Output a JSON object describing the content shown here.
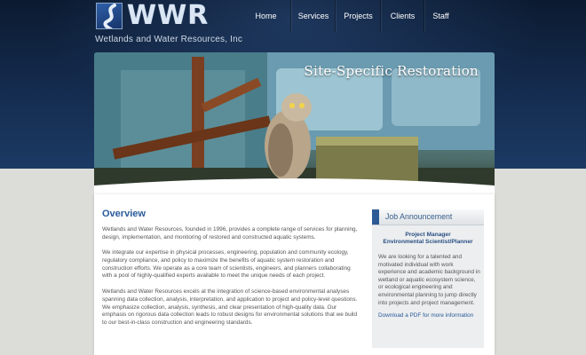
{
  "brand": {
    "logo_text": "WWR",
    "tagline": "Wetlands and Water Resources, Inc"
  },
  "nav": {
    "items": [
      {
        "label": "Home"
      },
      {
        "label": "Services"
      },
      {
        "label": "Projects"
      },
      {
        "label": "Clients"
      },
      {
        "label": "Staff"
      }
    ]
  },
  "hero": {
    "title": "Site-Specific Restoration"
  },
  "overview": {
    "heading": "Overview",
    "paragraphs": [
      "Wetlands and Water Resources, founded in 1996, provides a complete range of services for planning, design, implementation, and monitoring of restored and constructed aquatic systems.",
      "We integrate our expertise in physical processes, engineering, population and community ecology, regulatory compliance, and policy to maximize the benefits of aquatic system restoration and construction efforts. We operate as a core team of scientists, engineers, and planners collaborating with a pool of highly-qualified experts available to meet the unique needs of each project.",
      "Wetlands and Water Resources excels at the integration of science-based environmental analyses spanning data collection, analysis, interpretation, and application to project and policy-level questions. We emphasize collection, analysis, synthesis, and clear presentation of high-quality data. Our emphasis on rigorous data collection leads to robust designs for environmental solutions that we build to our best-in-class construction and engineering standards."
    ]
  },
  "sidebar": {
    "heading": "Job Announcement",
    "job_title_line1": "Project Manager",
    "job_title_line2": "Environmental Scientist/Planner",
    "body": "We are looking for a talented and motivated individual with work experience and academic background in wetland or aquatic ecosystem science, or ecological engineering and environmental planning to jump directly into projects and project management.",
    "link_text": "Download a PDF for more information"
  },
  "colors": {
    "header_dark": "#0b1a30",
    "accent_blue": "#2a5a9a",
    "panel_bg": "#ffffff",
    "page_bg": "#dcdcd8"
  }
}
